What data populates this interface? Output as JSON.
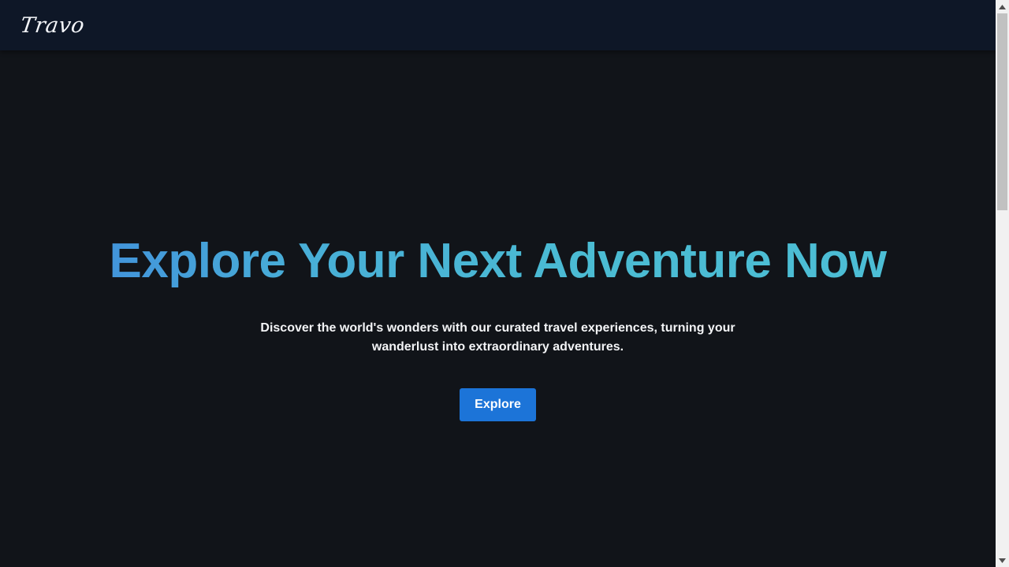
{
  "nav": {
    "logo": "Travo"
  },
  "hero": {
    "title": "Explore Your Next Adventure Now",
    "subtitle": "Discover the world's wonders with our curated travel experiences, turning your wanderlust into extraordinary adventures.",
    "cta_label": "Explore"
  },
  "icons": {
    "scroll_up": "scroll-up-arrow-icon",
    "scroll_down": "scroll-down-arrow-icon"
  },
  "colors": {
    "page_background": "#111419",
    "navbar_background": "#0e1727",
    "title_gradient_start": "#3f86dd",
    "title_gradient_end": "#4cbed6",
    "button_background": "#1c74d8",
    "text": "#f3f4f6"
  }
}
